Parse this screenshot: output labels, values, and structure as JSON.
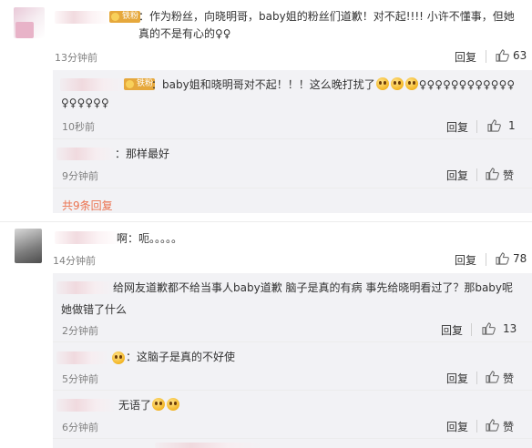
{
  "comments": [
    {
      "badge": "铁粉",
      "text": "：作为粉丝，向晓明哥，baby姐的粉丝们道歉！对不起!!!! 小许不懂事，但她真的不是有心的♀♀",
      "time": "13分钟前",
      "reply_label": "回复",
      "likes": "63",
      "subreplies": [
        {
          "badge": "铁粉",
          "text": "：baby姐和晓明哥对不起！！！这么晚打扰了",
          "text2": "♀♀♀♀♀♀♀♀♀♀♀♀",
          "tail": "♀♀♀♀♀♀",
          "time": "10秒前",
          "reply_label": "回复",
          "likes": "1"
        },
        {
          "text": "：那样最好",
          "time": "9分钟前",
          "reply_label": "回复",
          "likes": "赞"
        }
      ],
      "more_replies": "共9条回复"
    },
    {
      "name_tail": "啊",
      "text": "：呃。。。。。",
      "time": "14分钟前",
      "reply_label": "回复",
      "likes": "78",
      "subreplies": [
        {
          "text": "给网友道歉都不给当事人baby道歉 脑子是真的有病 事先给晓明看过了？那baby呢",
          "text2": "她做错了什么",
          "time": "2分钟前",
          "reply_label": "回复",
          "likes": "13"
        },
        {
          "text": "：这脑子是真的不好使",
          "time": "5分钟前",
          "reply_label": "回复",
          "likes": "赞"
        },
        {
          "text": "无语了",
          "time": "6分钟前",
          "reply_label": "回复",
          "likes": "赞"
        }
      ]
    }
  ]
}
